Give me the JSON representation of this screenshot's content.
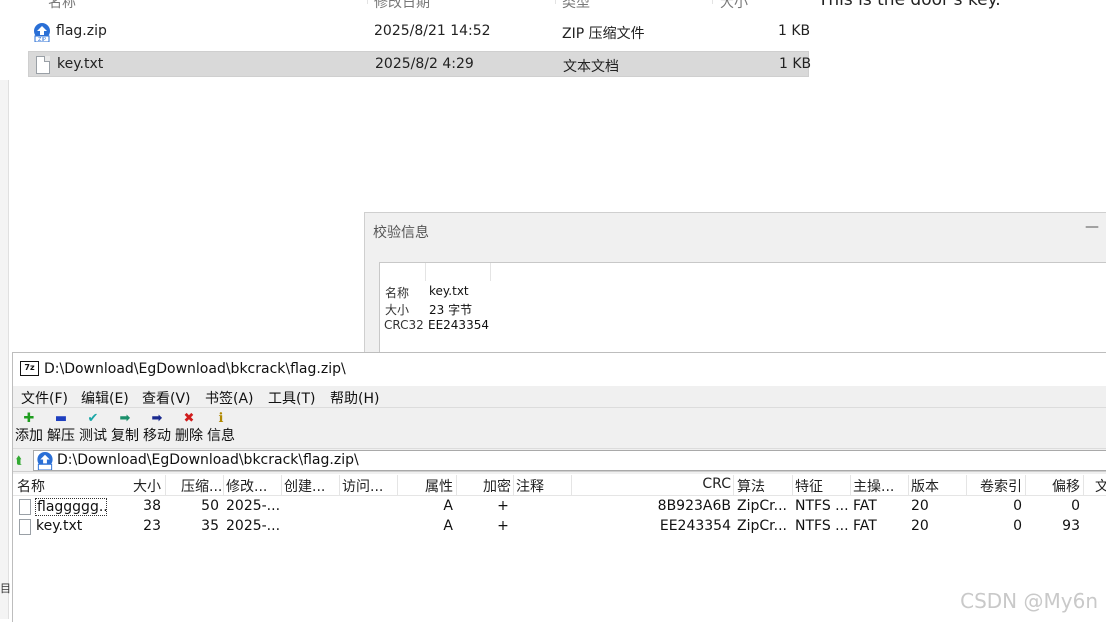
{
  "explorer": {
    "columns": [
      "名称",
      "修改日期",
      "类型",
      "大小"
    ],
    "rows": [
      {
        "name": "flag.zip",
        "date": "2025/8/21 14:52",
        "type": "ZIP 压缩文件",
        "size": "1 KB"
      },
      {
        "name": "key.txt",
        "date": "2025/8/2 4:29",
        "type": "文本文档",
        "size": "1 KB"
      }
    ]
  },
  "text_preview": "This is the door's key.",
  "verify_dialog": {
    "title": "校验信息",
    "minimize": "—",
    "rows": [
      {
        "key": "名称",
        "value": "key.txt"
      },
      {
        "key": "大小",
        "value": "23 字节"
      },
      {
        "key": "CRC32",
        "value": "EE243354"
      }
    ]
  },
  "sevenzip": {
    "logo": "7z",
    "title": "D:\\Download\\EgDownload\\bkcrack\\flag.zip\\",
    "menu": [
      "文件(F)",
      "编辑(E)",
      "查看(V)",
      "书签(A)",
      "工具(T)",
      "帮助(H)"
    ],
    "toolbar": [
      {
        "label": "添加",
        "icon": "plus-icon",
        "glyph": "✚",
        "color": "#1f9d1f"
      },
      {
        "label": "解压",
        "icon": "minus-icon",
        "glyph": "▬",
        "color": "#1e3fbf"
      },
      {
        "label": "测试",
        "icon": "check-icon",
        "glyph": "✔",
        "color": "#1aa6a6"
      },
      {
        "label": "复制",
        "icon": "copy-arrow-icon",
        "glyph": "➡",
        "color": "#1a8f6a"
      },
      {
        "label": "移动",
        "icon": "move-arrow-icon",
        "glyph": "➡",
        "color": "#1a2a8f"
      },
      {
        "label": "删除",
        "icon": "delete-x-icon",
        "glyph": "✖",
        "color": "#d01c1c"
      },
      {
        "label": "信息",
        "icon": "info-icon",
        "glyph": "ℹ",
        "color": "#b08800"
      }
    ],
    "address": "D:\\Download\\EgDownload\\bkcrack\\flag.zip\\",
    "columns": [
      "名称",
      "大小",
      "压缩...",
      "修改...",
      "创建...",
      "访问...",
      "属性",
      "加密",
      "注释",
      "CRC",
      "算法",
      "特征",
      "主操...",
      "版本",
      "卷索引",
      "偏移",
      "文"
    ],
    "files": [
      {
        "name": "flaggggg...",
        "size": "38",
        "packed": "50",
        "modified": "2025-...",
        "attr": "A",
        "enc": "+",
        "crc": "8B923A6B",
        "method": "ZipCr...",
        "char": "NTFS ...",
        "host": "FAT",
        "ver": "20",
        "vol": "0",
        "offset": "0"
      },
      {
        "name": "key.txt",
        "size": "23",
        "packed": "35",
        "modified": "2025-...",
        "attr": "A",
        "enc": "+",
        "crc": "EE243354",
        "method": "ZipCr...",
        "char": "NTFS ...",
        "host": "FAT",
        "ver": "20",
        "vol": "0",
        "offset": "93"
      }
    ]
  },
  "watermark": "CSDN @My6n",
  "colors": {
    "accent_blue": "#2a6fd6",
    "selection": "#d9d9d9"
  }
}
